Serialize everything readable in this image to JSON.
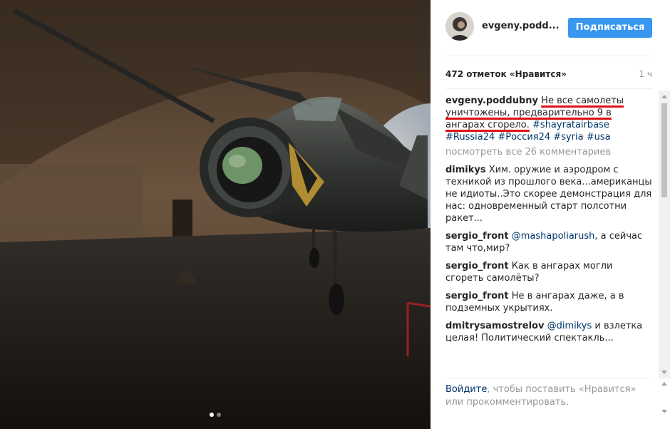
{
  "post": {
    "username": "evgeny.podd...",
    "follow_label": "Подписаться",
    "likes": "472 отметок «Нравится»",
    "time": "1 ч"
  },
  "caption": {
    "username": "evgeny.poddubny",
    "text_underlined": "Не все самолеты уничтожены, предварительно 9 в ангарах сгорело.",
    "hashtags": "#shayratairbase #Russia24 #Россия24 #syria #usa"
  },
  "view_all": "посмотреть все 26 комментариев",
  "comments": [
    {
      "user": "dimikys",
      "mention": "",
      "text": "Хим. оружие и аэродром с техникой из прошлого века...американцы не идиоты..Это скорее демонстрация для нас: одновременный старт полсотни ракет..."
    },
    {
      "user": "sergio_front",
      "mention": "@mashapoliarush",
      "text": ", а сейчас там что,мир?"
    },
    {
      "user": "sergio_front",
      "mention": "",
      "text": "Как в ангарах могли сгореть самолёты?"
    },
    {
      "user": "sergio_front",
      "mention": "",
      "text": "Не в ангарах даже, а в подземных укрытиях."
    },
    {
      "user": "dmitrysamostrelov",
      "mention": "@dimikys",
      "text": " и взлетка целая! Политический спектакль..."
    }
  ],
  "footer": {
    "login_link": "Войдите",
    "rest": ", чтобы поставить «Нравится» или прокомментировать."
  },
  "icons": {
    "avatar": "avatar-image",
    "dots": "carousel-dots"
  }
}
